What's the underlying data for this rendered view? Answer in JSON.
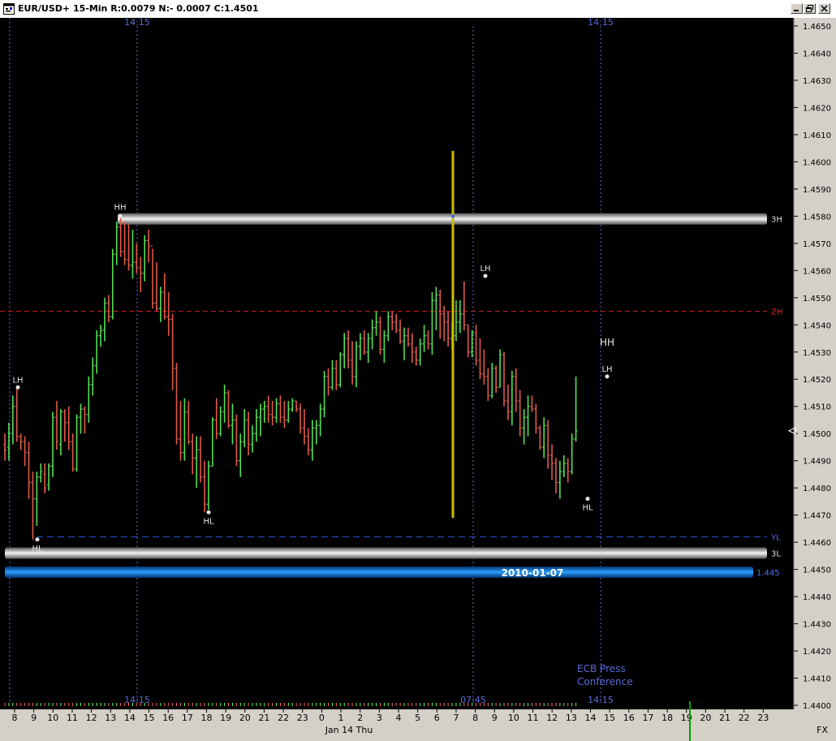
{
  "window": {
    "title": "EUR/USD+ 15-Min R:0.0079 N:- 0.0007 C:1.4501"
  },
  "chart_data": {
    "type": "bar",
    "subtype": "ohlc",
    "symbol": "EUR/USD+",
    "interval": "15-Min",
    "ylim": [
      1.44,
      1.4652
    ],
    "y_ticks": [
      "1.4650",
      "1.4640",
      "1.4630",
      "1.4620",
      "1.4610",
      "1.4600",
      "1.4590",
      "1.4580",
      "1.4570",
      "1.4560",
      "1.4550",
      "1.4540",
      "1.4530",
      "1.4520",
      "1.4510",
      "1.4500",
      "1.4490",
      "1.4480",
      "1.4470",
      "1.4460",
      "1.4450",
      "1.4440",
      "1.4430",
      "1.4420",
      "1.4410",
      "1.4400"
    ],
    "x_ticks": [
      "8",
      "9",
      "10",
      "11",
      "12",
      "13",
      "14",
      "15",
      "16",
      "17",
      "18",
      "19",
      "20",
      "21",
      "22",
      "23",
      "0",
      "1",
      "2",
      "3",
      "4",
      "5",
      "6",
      "7",
      "8",
      "9",
      "10",
      "11",
      "12",
      "13",
      "14",
      "15",
      "16",
      "17",
      "18",
      "19",
      "20",
      "21",
      "22",
      "23"
    ],
    "x_date_label": "Jan 14 Thu",
    "x_axis_right_label": "FX",
    "time_markers": [
      {
        "label": "14:15",
        "top": true,
        "bottom": true
      },
      {
        "label": "07:45",
        "top": false,
        "bottom": true
      },
      {
        "label": "14:15",
        "top": true,
        "bottom": true
      }
    ],
    "levels": [
      {
        "label": "3H",
        "value": 1.4579,
        "style": "silver-band"
      },
      {
        "label": "ZH",
        "value": 1.4545,
        "style": "red-dash"
      },
      {
        "label": "YL",
        "value": 1.4462,
        "style": "blue-dash"
      },
      {
        "label": "3L",
        "value": 1.4456,
        "style": "silver-band"
      },
      {
        "label": "1.445",
        "value": 1.4449,
        "style": "blue-band",
        "band_text": "2010-01-07"
      }
    ],
    "current_price": 1.4501,
    "annotations": [
      {
        "text": "HH",
        "value": 1.458
      },
      {
        "text": "LH",
        "value": 1.4517
      },
      {
        "text": "HL",
        "value": 1.4461
      },
      {
        "text": "HL",
        "value": 1.4471
      },
      {
        "text": "LH",
        "value": 1.4558
      },
      {
        "text": "LH",
        "value": 1.4521
      },
      {
        "text": "HH",
        "value": 1.4527
      },
      {
        "text": "HL",
        "value": 1.4476
      }
    ],
    "news": [
      "ECB Press",
      "Conference"
    ],
    "series": [
      {
        "name": "EUR/USD+",
        "ohlc": [
          [
            1.4496,
            1.45,
            1.449,
            1.4494
          ],
          [
            1.4495,
            1.4504,
            1.449,
            1.45
          ],
          [
            1.45,
            1.4514,
            1.4496,
            1.451
          ],
          [
            1.451,
            1.4517,
            1.4497,
            1.4499
          ],
          [
            1.4499,
            1.45,
            1.4494,
            1.4497
          ],
          [
            1.4497,
            1.4499,
            1.4488,
            1.4493
          ],
          [
            1.4493,
            1.4497,
            1.4476,
            1.4482
          ],
          [
            1.4482,
            1.4486,
            1.4461,
            1.4476
          ],
          [
            1.4476,
            1.4486,
            1.4466,
            1.4484
          ],
          [
            1.4484,
            1.4489,
            1.4482,
            1.4486
          ],
          [
            1.4485,
            1.4489,
            1.4478,
            1.448
          ],
          [
            1.4481,
            1.4489,
            1.4479,
            1.4488
          ],
          [
            1.4488,
            1.4508,
            1.4484,
            1.4506
          ],
          [
            1.4506,
            1.4512,
            1.4494,
            1.4497
          ],
          [
            1.4496,
            1.4509,
            1.4492,
            1.4508
          ],
          [
            1.4508,
            1.4509,
            1.4497,
            1.4504
          ],
          [
            1.4504,
            1.451,
            1.4494,
            1.4497
          ],
          [
            1.4497,
            1.45,
            1.4486,
            1.4487
          ],
          [
            1.4487,
            1.4507,
            1.4486,
            1.4506
          ],
          [
            1.4506,
            1.4511,
            1.45,
            1.4509
          ],
          [
            1.4509,
            1.451,
            1.45,
            1.4507
          ],
          [
            1.4507,
            1.4521,
            1.4504,
            1.4518
          ],
          [
            1.4518,
            1.4528,
            1.4514,
            1.4525
          ],
          [
            1.4525,
            1.4538,
            1.4522,
            1.4536
          ],
          [
            1.4536,
            1.454,
            1.4532,
            1.4538
          ],
          [
            1.4538,
            1.455,
            1.4534,
            1.4548
          ],
          [
            1.4548,
            1.4551,
            1.4541,
            1.4543
          ],
          [
            1.4543,
            1.4568,
            1.4542,
            1.4566
          ],
          [
            1.4566,
            1.4578,
            1.4562,
            1.4576
          ],
          [
            1.4576,
            1.458,
            1.4565,
            1.4567
          ],
          [
            1.4567,
            1.4578,
            1.4562,
            1.4564
          ],
          [
            1.4564,
            1.4577,
            1.456,
            1.4562
          ],
          [
            1.4562,
            1.4575,
            1.4557,
            1.4563
          ],
          [
            1.4563,
            1.457,
            1.4559,
            1.4561
          ],
          [
            1.4561,
            1.4565,
            1.4552,
            1.4559
          ],
          [
            1.4559,
            1.4573,
            1.4556,
            1.4571
          ],
          [
            1.4571,
            1.4575,
            1.4563,
            1.4569
          ],
          [
            1.4569,
            1.4568,
            1.4546,
            1.4548
          ],
          [
            1.4548,
            1.4563,
            1.4545,
            1.4546
          ],
          [
            1.4546,
            1.4554,
            1.4541,
            1.4552
          ],
          [
            1.4552,
            1.4559,
            1.4542,
            1.4543
          ],
          [
            1.4543,
            1.4552,
            1.4536,
            1.4542
          ],
          [
            1.4542,
            1.4544,
            1.4516,
            1.4524
          ],
          [
            1.4524,
            1.4526,
            1.4496,
            1.4498
          ],
          [
            1.4498,
            1.4512,
            1.449,
            1.4493
          ],
          [
            1.4493,
            1.4513,
            1.449,
            1.4508
          ],
          [
            1.4508,
            1.4512,
            1.4496,
            1.4497
          ],
          [
            1.4497,
            1.45,
            1.4485,
            1.4491
          ],
          [
            1.4491,
            1.4499,
            1.448,
            1.4494
          ],
          [
            1.4494,
            1.4499,
            1.4482,
            1.4484
          ],
          [
            1.4484,
            1.449,
            1.4471,
            1.4474
          ],
          [
            1.4474,
            1.449,
            1.4472,
            1.4488
          ],
          [
            1.4488,
            1.4506,
            1.4488,
            1.4505
          ],
          [
            1.4505,
            1.4513,
            1.4498,
            1.45
          ],
          [
            1.45,
            1.451,
            1.4499,
            1.4508
          ],
          [
            1.4508,
            1.4518,
            1.4504,
            1.4515
          ],
          [
            1.4515,
            1.4516,
            1.4502,
            1.4503
          ],
          [
            1.4503,
            1.4511,
            1.4496,
            1.4505
          ],
          [
            1.4505,
            1.4507,
            1.4488,
            1.449
          ],
          [
            1.449,
            1.45,
            1.4484,
            1.4497
          ],
          [
            1.4497,
            1.4509,
            1.4495,
            1.4505
          ],
          [
            1.4505,
            1.4508,
            1.4492,
            1.4496
          ],
          [
            1.4496,
            1.4503,
            1.4493,
            1.45
          ],
          [
            1.45,
            1.4509,
            1.4497,
            1.4506
          ],
          [
            1.4506,
            1.4511,
            1.4499,
            1.4509
          ],
          [
            1.4509,
            1.4512,
            1.4504,
            1.451
          ],
          [
            1.451,
            1.4514,
            1.4504,
            1.4507
          ],
          [
            1.4507,
            1.4512,
            1.4503,
            1.4506
          ],
          [
            1.4506,
            1.4513,
            1.4504,
            1.4511
          ],
          [
            1.4511,
            1.4514,
            1.4504,
            1.4506
          ],
          [
            1.4506,
            1.4512,
            1.4502,
            1.4505
          ],
          [
            1.4505,
            1.4512,
            1.4504,
            1.4509
          ],
          [
            1.4509,
            1.4513,
            1.4508,
            1.4512
          ],
          [
            1.4512,
            1.4512,
            1.4508,
            1.4509
          ],
          [
            1.4509,
            1.4511,
            1.45,
            1.4502
          ],
          [
            1.4502,
            1.4509,
            1.4496,
            1.4499
          ],
          [
            1.4499,
            1.4502,
            1.4492,
            1.4494
          ],
          [
            1.4494,
            1.4505,
            1.449,
            1.4502
          ],
          [
            1.4502,
            1.4505,
            1.4496,
            1.4503
          ],
          [
            1.4503,
            1.4511,
            1.4499,
            1.4509
          ],
          [
            1.4509,
            1.4523,
            1.4506,
            1.4521
          ],
          [
            1.4521,
            1.4524,
            1.4514,
            1.4517
          ],
          [
            1.4517,
            1.4527,
            1.4516,
            1.4524
          ],
          [
            1.4524,
            1.4527,
            1.4516,
            1.4518
          ],
          [
            1.4518,
            1.453,
            1.4517,
            1.4529
          ],
          [
            1.4529,
            1.4537,
            1.4524,
            1.4535
          ],
          [
            1.4535,
            1.4538,
            1.4524,
            1.4527
          ],
          [
            1.4527,
            1.4534,
            1.4518,
            1.4521
          ],
          [
            1.4521,
            1.4534,
            1.4517,
            1.4532
          ],
          [
            1.4532,
            1.4537,
            1.4527,
            1.4535
          ],
          [
            1.4535,
            1.4538,
            1.4529,
            1.453
          ],
          [
            1.453,
            1.4537,
            1.4526,
            1.4535
          ],
          [
            1.4535,
            1.4542,
            1.4531,
            1.4539
          ],
          [
            1.4539,
            1.4545,
            1.4536,
            1.4541
          ],
          [
            1.4541,
            1.4543,
            1.4529,
            1.4531
          ],
          [
            1.4531,
            1.4538,
            1.4526,
            1.4536
          ],
          [
            1.4536,
            1.4545,
            1.4534,
            1.4543
          ],
          [
            1.4543,
            1.4545,
            1.4538,
            1.4541
          ],
          [
            1.4541,
            1.4544,
            1.4537,
            1.4538
          ],
          [
            1.4538,
            1.4542,
            1.4533,
            1.4534
          ],
          [
            1.4534,
            1.4539,
            1.4527,
            1.4536
          ],
          [
            1.4536,
            1.4539,
            1.4532,
            1.4533
          ],
          [
            1.4533,
            1.4537,
            1.4526,
            1.453
          ],
          [
            1.453,
            1.4532,
            1.4525,
            1.4527
          ],
          [
            1.4527,
            1.4535,
            1.4525,
            1.4533
          ],
          [
            1.4533,
            1.454,
            1.453,
            1.4536
          ],
          [
            1.4536,
            1.4538,
            1.4531,
            1.4533
          ],
          [
            1.4533,
            1.4552,
            1.4529,
            1.4549
          ],
          [
            1.4549,
            1.4554,
            1.4538,
            1.4551
          ],
          [
            1.4551,
            1.4553,
            1.4535,
            1.4544
          ],
          [
            1.4544,
            1.4547,
            1.4534,
            1.4541
          ],
          [
            1.4541,
            1.4545,
            1.4532,
            1.4535
          ],
          [
            1.4535,
            1.4541,
            1.4531,
            1.4536
          ],
          [
            1.4536,
            1.4549,
            1.4534,
            1.4541
          ],
          [
            1.4541,
            1.4549,
            1.4537,
            1.4544
          ],
          [
            1.4544,
            1.4556,
            1.4538,
            1.454
          ],
          [
            1.454,
            1.454,
            1.4528,
            1.453
          ],
          [
            1.453,
            1.4538,
            1.4528,
            1.4537
          ],
          [
            1.4537,
            1.454,
            1.4525,
            1.4527
          ],
          [
            1.4527,
            1.4535,
            1.452,
            1.4522
          ],
          [
            1.4522,
            1.4531,
            1.4518,
            1.4521
          ],
          [
            1.4521,
            1.4524,
            1.4512,
            1.4514
          ],
          [
            1.4514,
            1.4526,
            1.4513,
            1.4524
          ],
          [
            1.4524,
            1.4525,
            1.4515,
            1.4517
          ],
          [
            1.4517,
            1.4531,
            1.4517,
            1.4529
          ],
          [
            1.4529,
            1.453,
            1.451,
            1.4512
          ],
          [
            1.4512,
            1.4518,
            1.4505,
            1.4508
          ],
          [
            1.4508,
            1.4523,
            1.4503,
            1.4521
          ],
          [
            1.4521,
            1.4524,
            1.4508,
            1.4512
          ],
          [
            1.4512,
            1.4516,
            1.4499,
            1.4502
          ],
          [
            1.4502,
            1.4509,
            1.4496,
            1.4506
          ],
          [
            1.4506,
            1.4514,
            1.4499,
            1.451
          ],
          [
            1.451,
            1.4514,
            1.4508,
            1.4509
          ],
          [
            1.4509,
            1.4511,
            1.45,
            1.4502
          ],
          [
            1.4502,
            1.4503,
            1.4494,
            1.4495
          ],
          [
            1.4495,
            1.4506,
            1.4491,
            1.4503
          ],
          [
            1.4503,
            1.4505,
            1.4487,
            1.4492
          ],
          [
            1.4492,
            1.4496,
            1.4483,
            1.4489
          ],
          [
            1.4489,
            1.4491,
            1.4478,
            1.4482
          ],
          [
            1.4482,
            1.449,
            1.4476,
            1.4486
          ],
          [
            1.4486,
            1.4492,
            1.4484,
            1.4489
          ],
          [
            1.4489,
            1.4491,
            1.4482,
            1.4486
          ],
          [
            1.4486,
            1.45,
            1.4485,
            1.4498
          ],
          [
            1.4498,
            1.4521,
            1.4497,
            1.4501
          ]
        ]
      }
    ]
  }
}
